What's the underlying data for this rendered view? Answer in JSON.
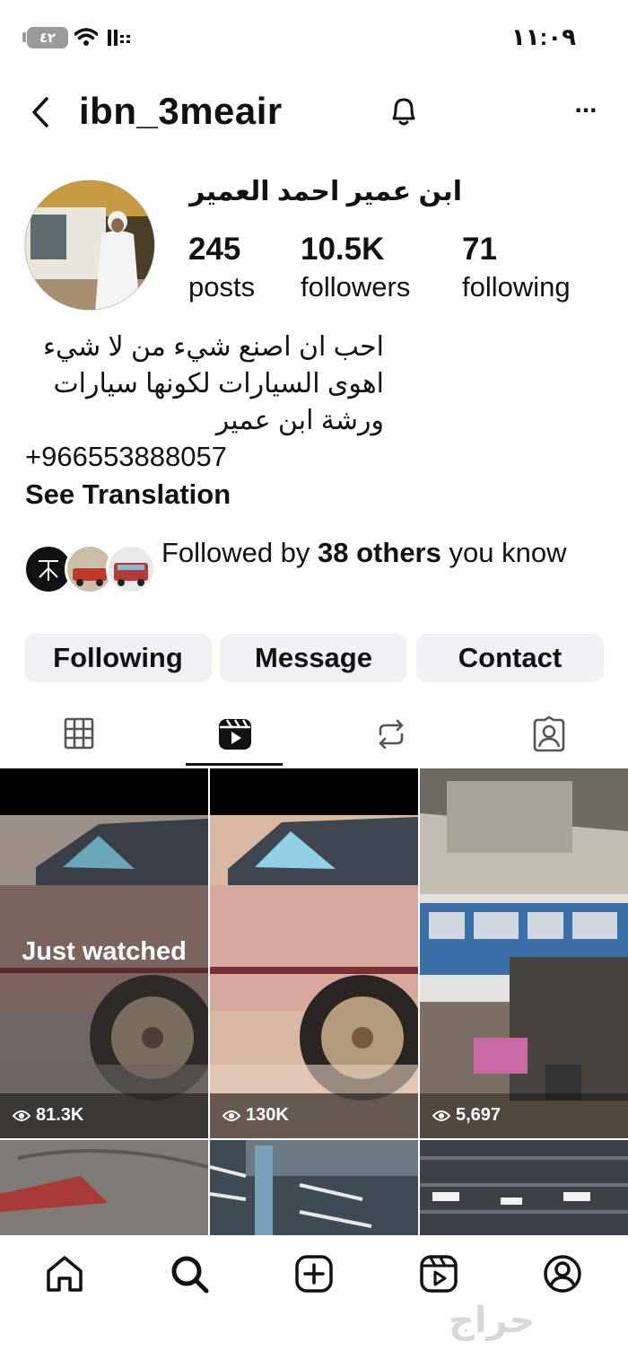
{
  "status_bar": {
    "battery": "٤٢",
    "time": "١١:٠٩"
  },
  "header": {
    "username": "ibn_3meair",
    "more_label": "..."
  },
  "profile": {
    "display_name": "ابن عمير احمد العمير",
    "stats": [
      {
        "value": "245",
        "label": "posts"
      },
      {
        "value": "10.5K",
        "label": "followers"
      },
      {
        "value": "71",
        "label": "following"
      }
    ],
    "bio": [
      "احب ان اصنع شيء من لا شيء",
      "اهوى السيارات لكونها سيارات",
      "ورشة ابن عمير"
    ],
    "phone": "+966553888057",
    "see_translation": "See Translation",
    "followed_by": {
      "prefix": "Followed by ",
      "count_text": "38 others",
      "suffix": " you know"
    }
  },
  "actions": {
    "following": "Following",
    "message": "Message",
    "contact": "Contact"
  },
  "tabs": [
    "grid",
    "reels",
    "reposts",
    "tagged"
  ],
  "active_tab": "reels",
  "reels": [
    {
      "views": "81.3K",
      "overlay": "Just watched"
    },
    {
      "views": "130K"
    },
    {
      "views": "5,697"
    }
  ],
  "bottom_nav": [
    "home",
    "search",
    "create",
    "reels",
    "profile"
  ],
  "watermark": "حراج"
}
